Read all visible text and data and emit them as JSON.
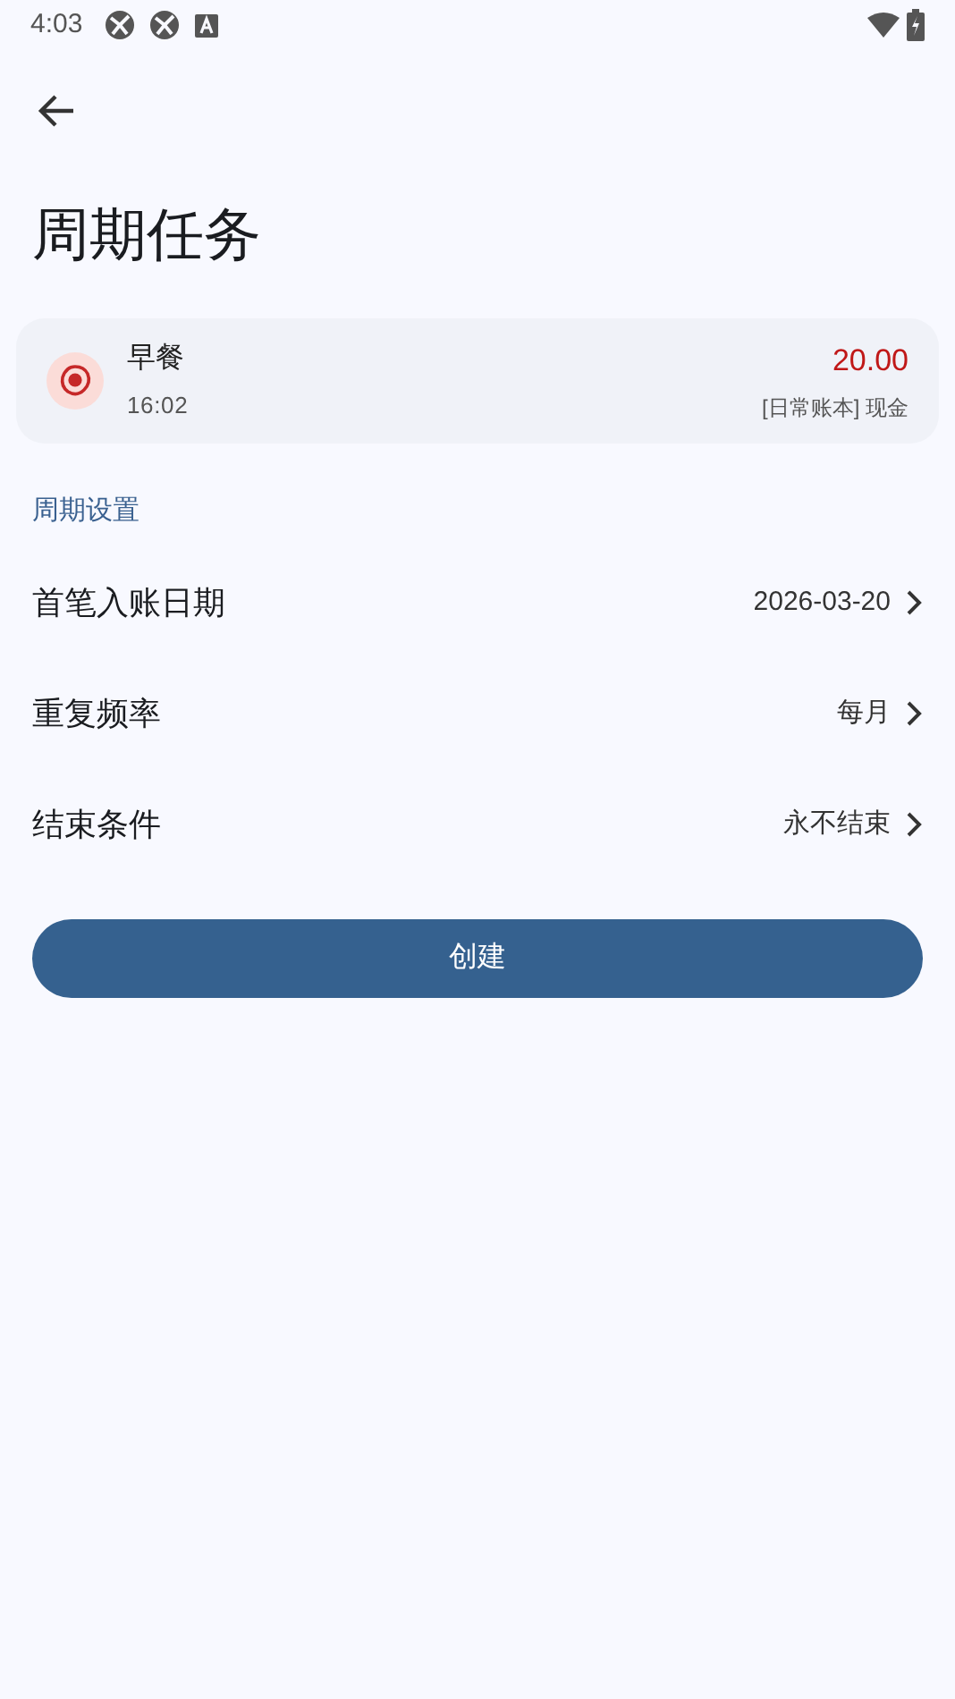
{
  "status_bar": {
    "time": "4:03"
  },
  "title": "周期任务",
  "record": {
    "name": "早餐",
    "time": "16:02",
    "amount": "20.00",
    "account": "[日常账本] 现金"
  },
  "section_title": "周期设置",
  "settings": [
    {
      "label": "首笔入账日期",
      "value": "2026-03-20"
    },
    {
      "label": "重复频率",
      "value": "每月"
    },
    {
      "label": "结束条件",
      "value": "永不结束"
    }
  ],
  "button": "创建"
}
